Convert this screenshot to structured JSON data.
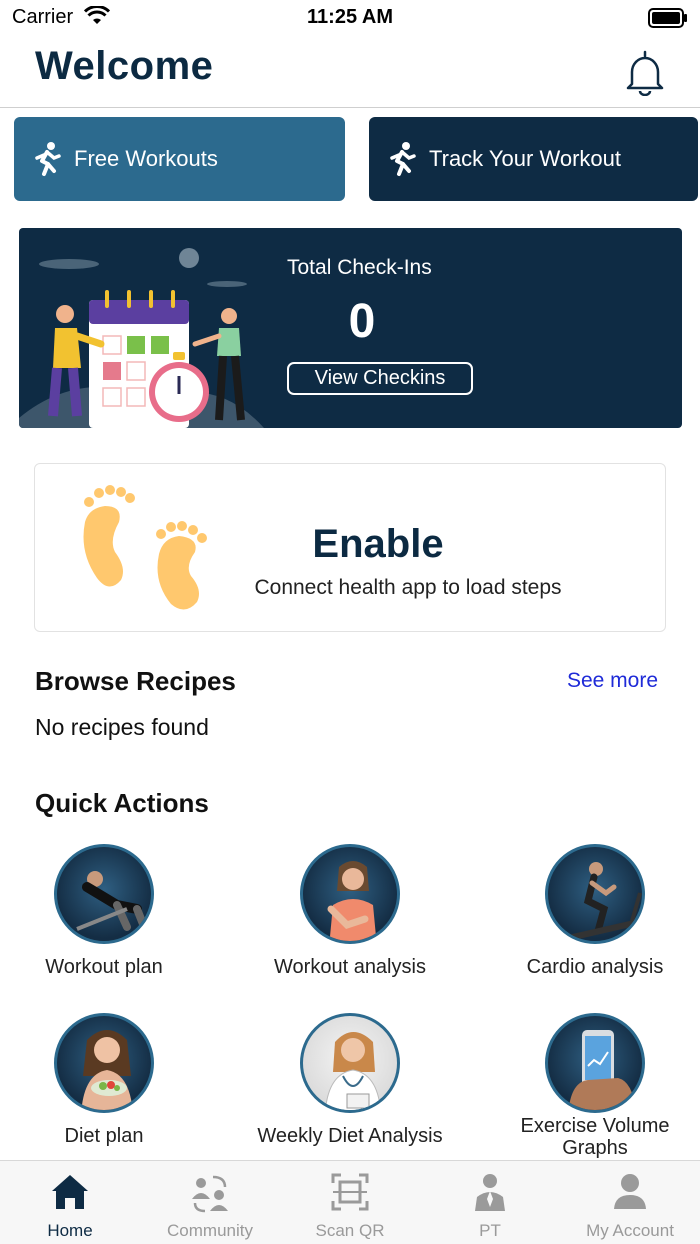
{
  "status": {
    "carrier": "Carrier",
    "time": "11:25 AM"
  },
  "header": {
    "title": "Welcome",
    "bell_icon": "bell-icon"
  },
  "top_buttons": {
    "free": {
      "label": "Free Workouts",
      "icon": "running-icon",
      "color": "#2c6a8e"
    },
    "track": {
      "label": "Track Your Workout",
      "icon": "running-icon",
      "color": "#0e2b44"
    }
  },
  "checkins": {
    "title": "Total Check-Ins",
    "count": "0",
    "button": "View Checkins"
  },
  "steps": {
    "title": "Enable",
    "subtitle": "Connect health app to load steps",
    "icon": "footprints-icon"
  },
  "recipes": {
    "title": "Browse Recipes",
    "see_more": "See more",
    "empty": "No recipes found"
  },
  "quick_actions": {
    "title": "Quick Actions",
    "items": [
      {
        "label": "Workout plan"
      },
      {
        "label": "Workout analysis"
      },
      {
        "label": "Cardio analysis"
      },
      {
        "label": "Diet plan"
      },
      {
        "label": "Weekly Diet Analysis"
      },
      {
        "label": "Exercise Volume Graphs"
      }
    ]
  },
  "nav": {
    "items": [
      {
        "label": "Home",
        "icon": "home-icon",
        "active": true
      },
      {
        "label": "Community",
        "icon": "community-icon",
        "active": false
      },
      {
        "label": "Scan QR",
        "icon": "scan-qr-icon",
        "active": false
      },
      {
        "label": "PT",
        "icon": "trainer-icon",
        "active": false
      },
      {
        "label": "My Account",
        "icon": "user-icon",
        "active": false
      }
    ]
  },
  "colors": {
    "navy": "#0e2b44",
    "accent": "#2c6a8e",
    "link": "#1f2bd8"
  }
}
